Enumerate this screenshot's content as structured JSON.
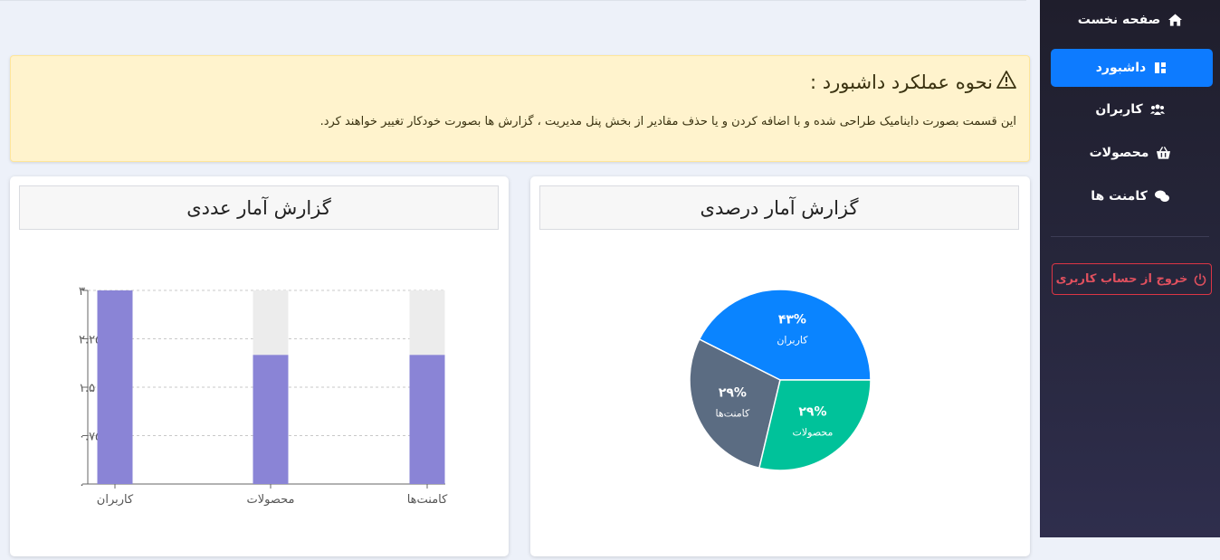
{
  "sidebar": {
    "items": [
      {
        "label": "صفحه نخست",
        "icon": "home-icon",
        "active": false
      },
      {
        "label": "داشبورد",
        "icon": "dashboard-icon",
        "active": true
      },
      {
        "label": "کاربران",
        "icon": "users-icon",
        "active": false
      },
      {
        "label": "محصولات",
        "icon": "basket-icon",
        "active": false
      },
      {
        "label": "کامنت ها",
        "icon": "comments-icon",
        "active": false
      }
    ],
    "logout_label": "خروج از حساب کاربری",
    "colors": {
      "active": "#0d7bff",
      "logout": "#dc3545"
    }
  },
  "alert": {
    "title": "نحوه عملکرد داشبورد :",
    "text": "این قسمت بصورت داینامیک طراحی شده و با اضافه کردن و یا حذف مقادیر از بخش پنل مدیریت ، گزارش ها بصورت خودکار تغییر خواهند کرد."
  },
  "pie_card": {
    "title": "گزارش آمار درصدی"
  },
  "bar_card": {
    "title": "گزارش آمار عددی"
  },
  "chart_data": [
    {
      "type": "pie",
      "labels": [
        "کاربران",
        "کامنت‌ها",
        "محصولات"
      ],
      "percent_labels": [
        "۴۳%",
        "۲۹%",
        "۲۹%"
      ],
      "values": [
        43,
        29,
        29
      ],
      "colors": [
        "#0a84ff",
        "#5b6c82",
        "#00c29a"
      ]
    },
    {
      "type": "bar",
      "categories": [
        "کاربران",
        "محصولات",
        "کامنت‌ها"
      ],
      "values": [
        3,
        2,
        2
      ],
      "max_values": [
        3,
        3,
        3
      ],
      "ylim": [
        0,
        3
      ],
      "yticks": [
        0,
        0.75,
        1.5,
        2.25,
        3
      ],
      "ytick_labels": [
        "۰",
        "۰.۷۵",
        "۱.۵",
        "۲.۲۵",
        "۳"
      ],
      "grid": true,
      "colors": {
        "bar": "#8a84d6",
        "background": "#ececec"
      }
    }
  ]
}
